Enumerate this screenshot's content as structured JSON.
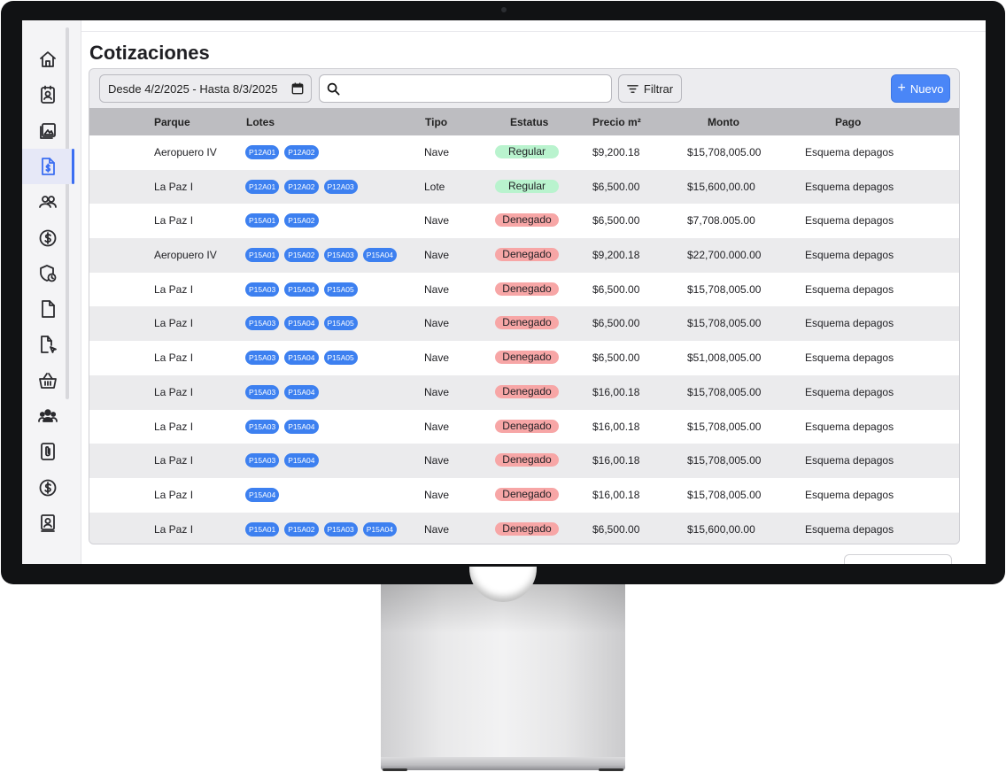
{
  "page": {
    "title": "Cotizaciones"
  },
  "toolbar": {
    "date_range": "Desde 4/2/2025 - Hasta 8/3/2025",
    "search_value": "",
    "filter_label": "Filtrar",
    "new_label": "Nuevo"
  },
  "sidebar": {
    "items": [
      {
        "icon": "home-icon"
      },
      {
        "icon": "contacts-icon"
      },
      {
        "icon": "gallery-icon"
      },
      {
        "icon": "quote-document-icon",
        "active": true
      },
      {
        "icon": "users-icon"
      },
      {
        "icon": "dollar-icon"
      },
      {
        "icon": "shield-clock-icon"
      },
      {
        "icon": "document-icon"
      },
      {
        "icon": "document-cursor-icon"
      },
      {
        "icon": "basket-icon"
      },
      {
        "icon": "group-icon"
      },
      {
        "icon": "attachment-icon"
      },
      {
        "icon": "payment-dollar-icon"
      },
      {
        "icon": "badge-icon"
      }
    ]
  },
  "table": {
    "columns": [
      "Parque",
      "Lotes",
      "Tipo",
      "Estatus",
      "Precio m²",
      "Monto",
      "Pago"
    ],
    "rows": [
      {
        "parque": "Aeropuero IV",
        "lotes": [
          "P12A01",
          "P12A02"
        ],
        "tipo": "Nave",
        "estatus": "Regular",
        "precio": "$9,200.18",
        "monto": "$15,708,005.00",
        "pago": "Esquema depagos"
      },
      {
        "parque": "La Paz I",
        "lotes": [
          "P12A01",
          "P12A02",
          "P12A03"
        ],
        "tipo": "Lote",
        "estatus": "Regular",
        "precio": "$6,500.00",
        "monto": "$15,600,00.00",
        "pago": "Esquema depagos"
      },
      {
        "parque": "La Paz I",
        "lotes": [
          "P15A01",
          "P15A02"
        ],
        "tipo": "Nave",
        "estatus": "Denegado",
        "precio": "$6,500.00",
        "monto": "$7,708.005.00",
        "pago": "Esquema depagos"
      },
      {
        "parque": "Aeropuero IV",
        "lotes": [
          "P15A01",
          "P15A02",
          "P15A03",
          "P15A04"
        ],
        "tipo": "Nave",
        "estatus": "Denegado",
        "precio": "$9,200.18",
        "monto": "$22,700.000.00",
        "pago": "Esquema depagos"
      },
      {
        "parque": "La Paz I",
        "lotes": [
          "P15A03",
          "P15A04",
          "P15A05"
        ],
        "tipo": "Nave",
        "estatus": "Denegado",
        "precio": "$6,500.00",
        "monto": "$15,708,005.00",
        "pago": "Esquema depagos"
      },
      {
        "parque": "La Paz I",
        "lotes": [
          "P15A03",
          "P15A04",
          "P15A05"
        ],
        "tipo": "Nave",
        "estatus": "Denegado",
        "precio": "$6,500.00",
        "monto": "$15,708,005.00",
        "pago": "Esquema depagos"
      },
      {
        "parque": "La Paz I",
        "lotes": [
          "P15A03",
          "P15A04",
          "P15A05"
        ],
        "tipo": "Nave",
        "estatus": "Denegado",
        "precio": "$6,500.00",
        "monto": "$51,008,005.00",
        "pago": "Esquema depagos"
      },
      {
        "parque": "La Paz I",
        "lotes": [
          "P15A03",
          "P15A04"
        ],
        "tipo": "Nave",
        "estatus": "Denegado",
        "precio": "$16,00.18",
        "monto": "$15,708,005.00",
        "pago": "Esquema depagos"
      },
      {
        "parque": "La Paz I",
        "lotes": [
          "P15A03",
          "P15A04"
        ],
        "tipo": "Nave",
        "estatus": "Denegado",
        "precio": "$16,00.18",
        "monto": "$15,708,005.00",
        "pago": "Esquema depagos"
      },
      {
        "parque": "La Paz I",
        "lotes": [
          "P15A03",
          "P15A04"
        ],
        "tipo": "Nave",
        "estatus": "Denegado",
        "precio": "$16,00.18",
        "monto": "$15,708,005.00",
        "pago": "Esquema depagos"
      },
      {
        "parque": "La Paz I",
        "lotes": [
          "P15A04"
        ],
        "tipo": "Nave",
        "estatus": "Denegado",
        "precio": "$16,00.18",
        "monto": "$15,708,005.00",
        "pago": "Esquema depagos"
      },
      {
        "parque": "La Paz I",
        "lotes": [
          "P15A01",
          "P15A02",
          "P15A03",
          "P15A04"
        ],
        "tipo": "Nave",
        "estatus": "Denegado",
        "precio": "$6,500.00",
        "monto": "$15,600,00.00",
        "pago": "Esquema depagos"
      }
    ]
  },
  "colors": {
    "accent": "#4a86f7",
    "chip": "#3d80f0",
    "status_regular": "#b9f3ce",
    "status_denegado": "#f7a6a6"
  }
}
